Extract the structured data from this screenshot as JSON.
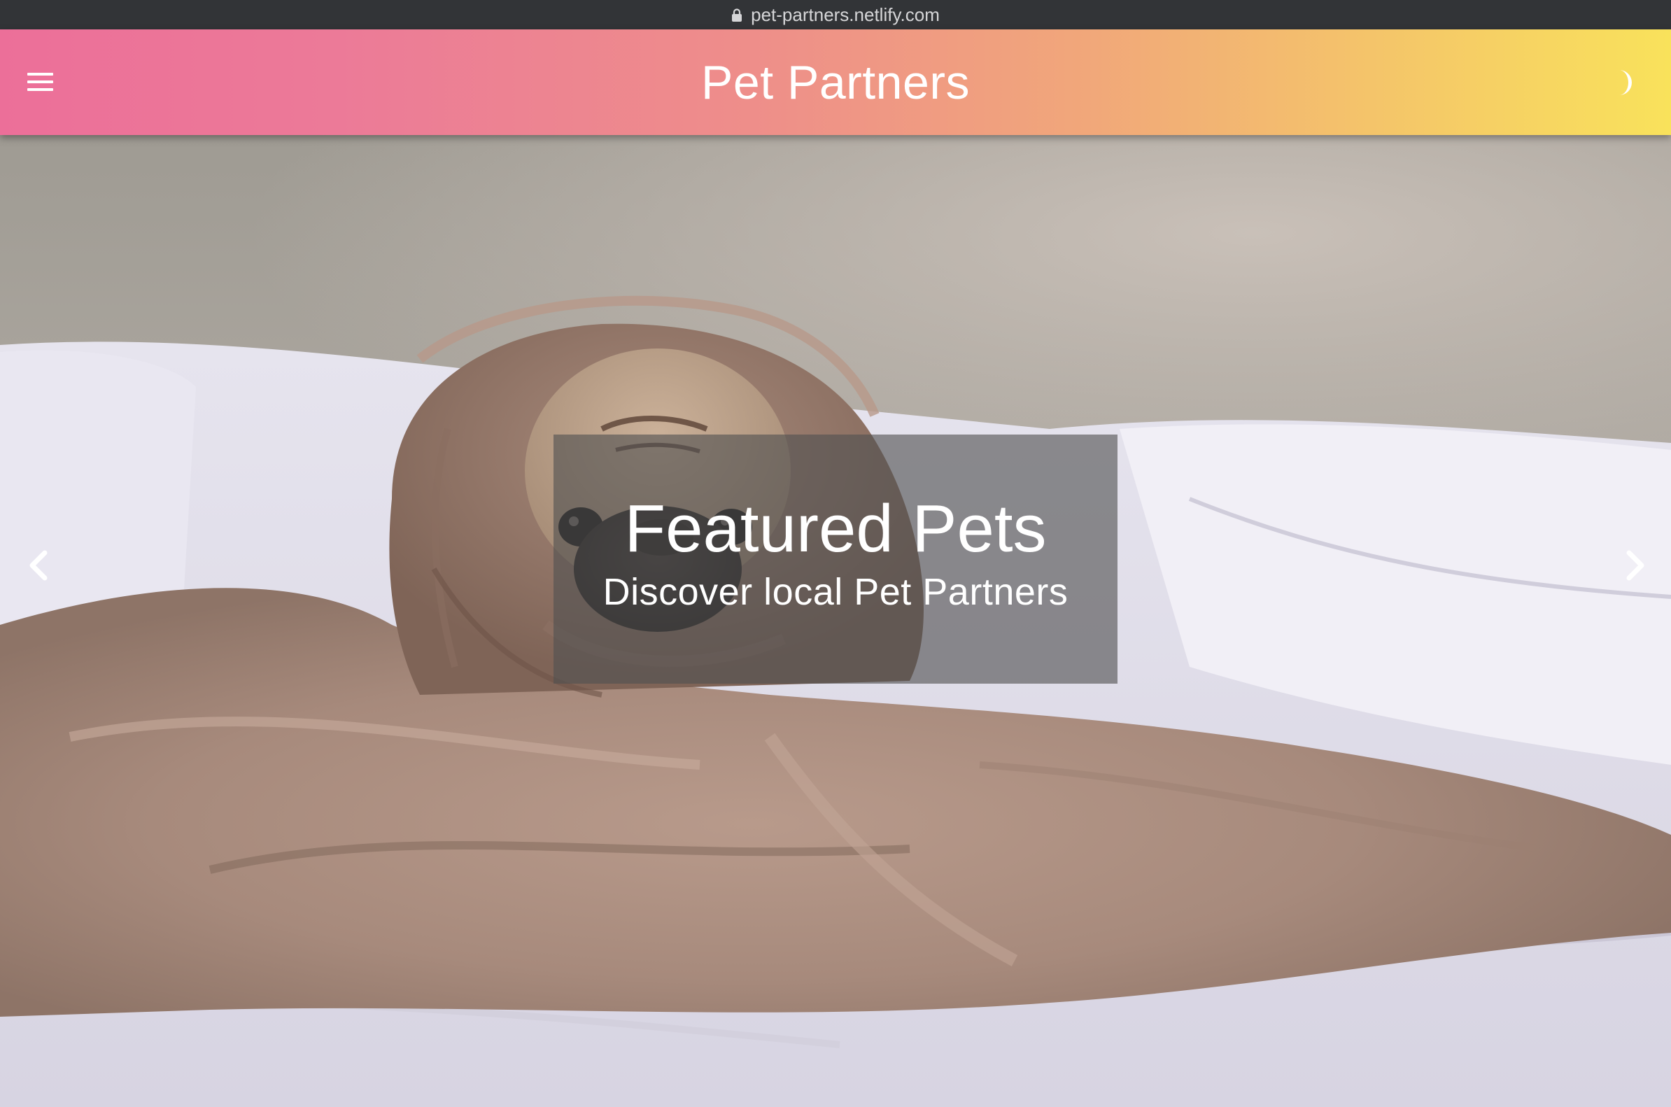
{
  "browser": {
    "url": "pet-partners.netlify.com",
    "lock_icon": "lock-icon"
  },
  "header": {
    "title": "Pet Partners",
    "menu_icon": "hamburger-menu-icon",
    "theme_icon": "moon-icon",
    "gradient_colors": [
      "#ec6f99",
      "#f1a77a",
      "#f9e25b"
    ]
  },
  "hero": {
    "heading": "Featured Pets",
    "subheading": "Discover local Pet Partners",
    "prev_icon": "chevron-left-icon",
    "next_icon": "chevron-right-icon"
  }
}
